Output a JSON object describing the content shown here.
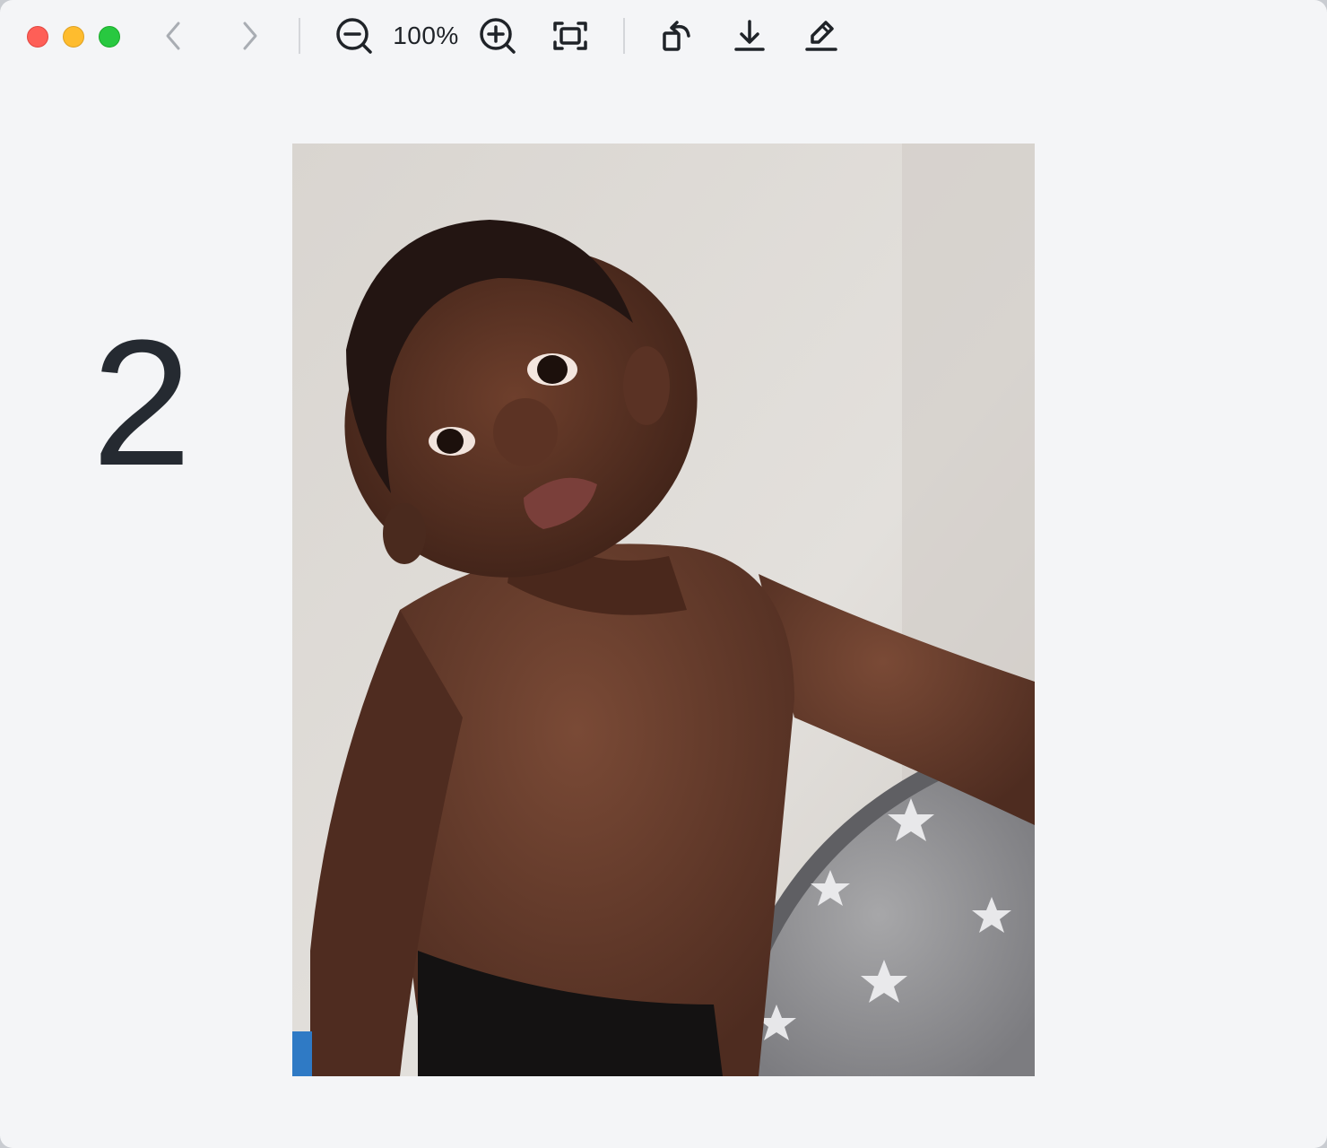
{
  "window": {
    "controls": [
      "close",
      "minimize",
      "maximize"
    ]
  },
  "toolbar": {
    "back_icon": "chevron-left-icon",
    "forward_icon": "chevron-right-icon",
    "zoom_out_icon": "zoom-out-icon",
    "zoom_level": "100%",
    "zoom_in_icon": "zoom-in-icon",
    "fit_icon": "fit-to-window-icon",
    "rotate_icon": "rotate-icon",
    "download_icon": "download-icon",
    "edit_icon": "edit-icon"
  },
  "viewer": {
    "page_number": "2"
  },
  "colors": {
    "background": "#f4f5f7",
    "icon": "#1f2328",
    "icon_disabled": "#a9adb3",
    "close": "#fe5f57",
    "minimize": "#febc2e",
    "maximize": "#28c840"
  }
}
